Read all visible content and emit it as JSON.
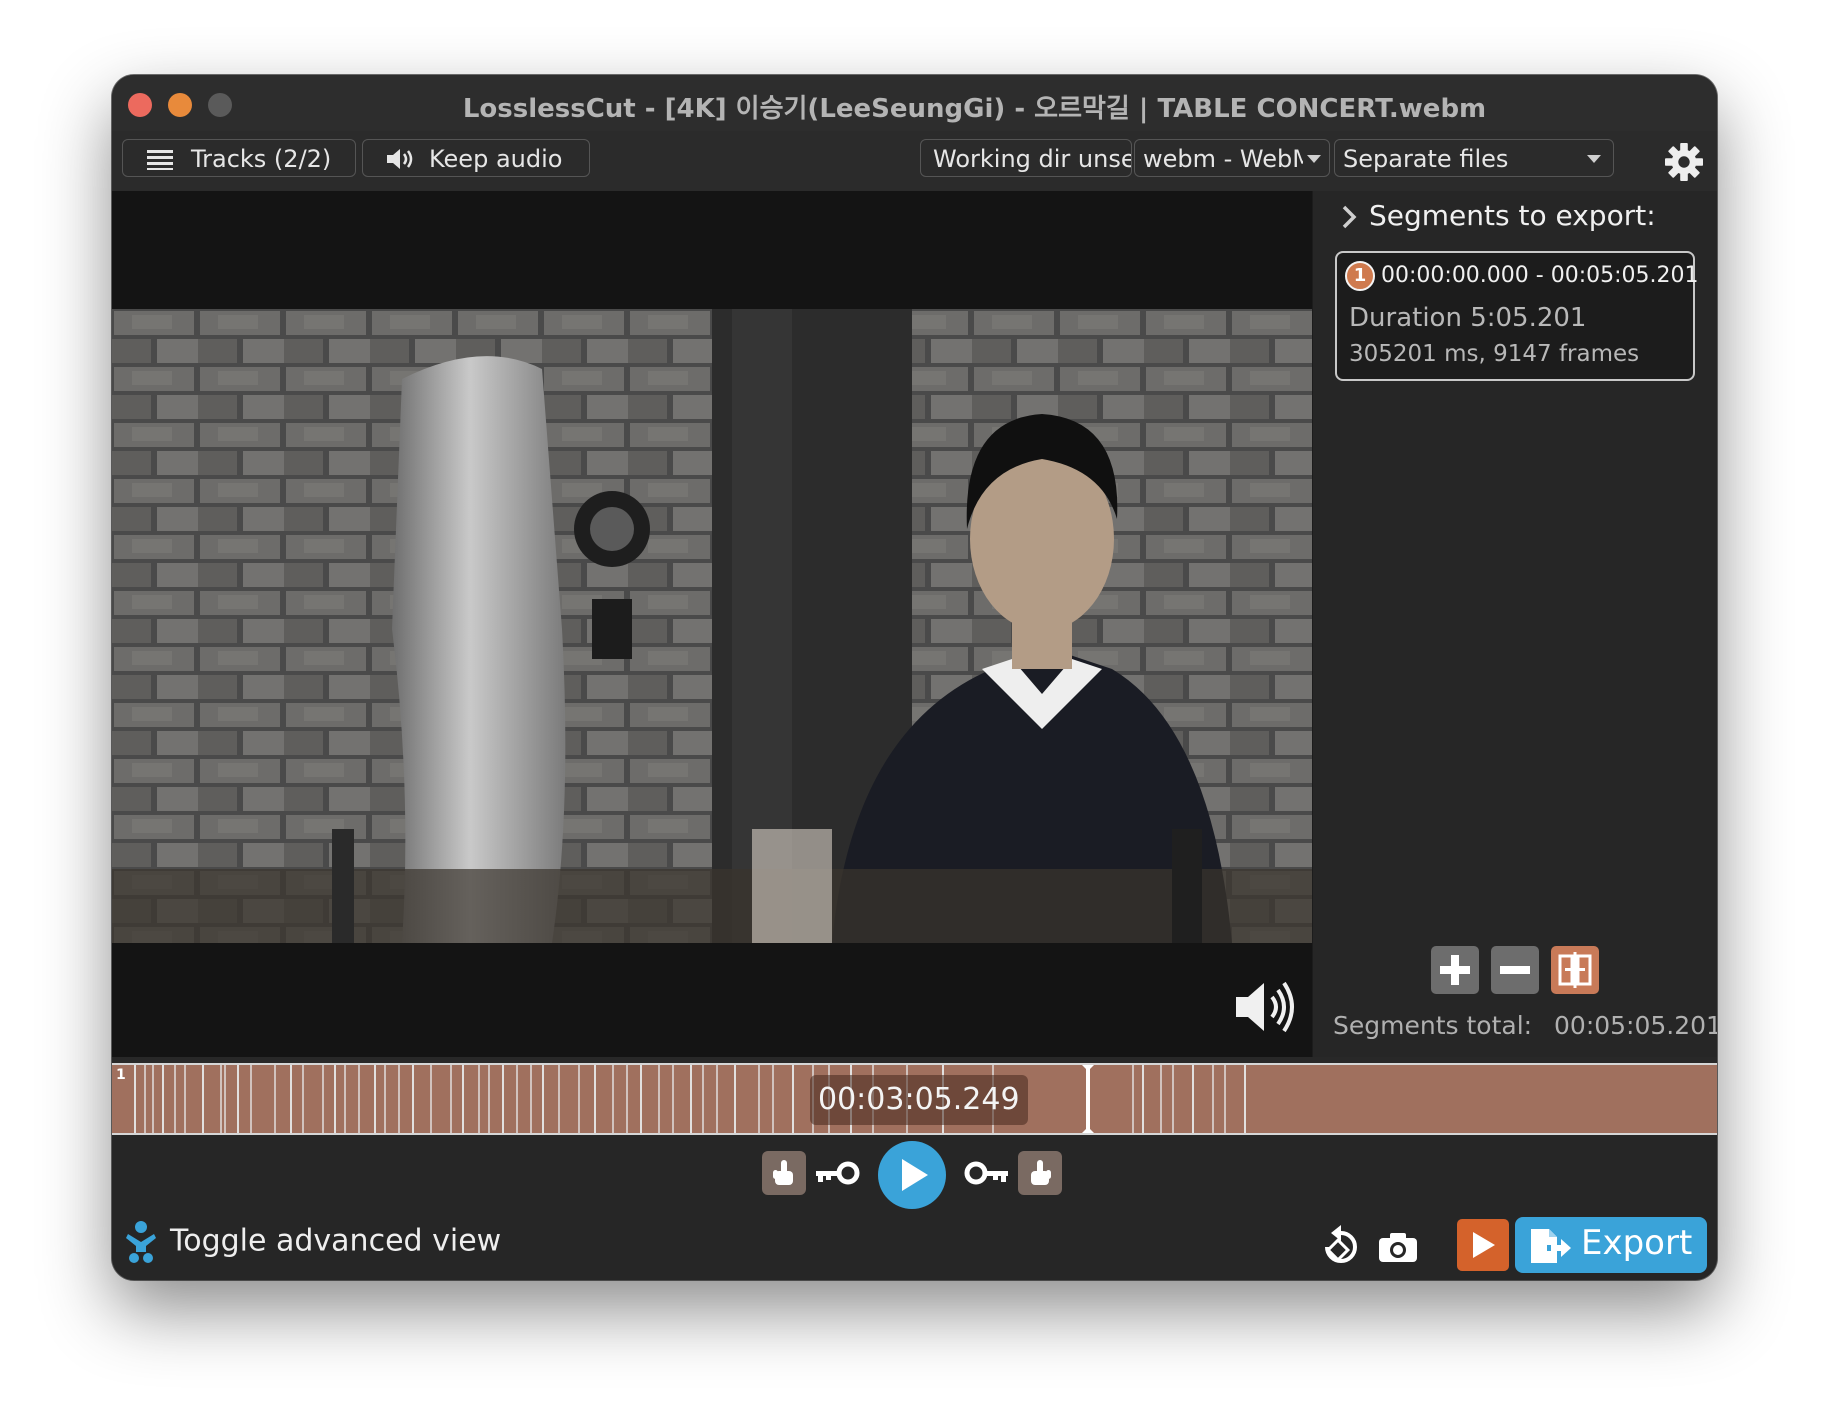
{
  "window": {
    "title": "LosslessCut - [4K] 이승기(LeeSeungGi) - 오르막길 | TABLE CONCERT.webm"
  },
  "toolbar": {
    "tracks_label": "Tracks (2/2)",
    "audio_label": "Keep audio",
    "working_dir_label": "Working dir unset",
    "format_label": "webm - WebM",
    "output_mode_label": "Separate files"
  },
  "segments": {
    "header": "Segments to export:",
    "items": [
      {
        "number": "1",
        "range": "00:00:00.000 - 00:05:05.201",
        "duration": "Duration 5:05.201",
        "detail": "305201 ms, 9147 frames"
      }
    ],
    "total_label": "Segments total:",
    "total_value": "00:05:05.201"
  },
  "timeline": {
    "segment_label": "1",
    "current_time": "00:03:05.249",
    "position": 0.607,
    "color": "#a0705e"
  },
  "controls": {
    "advanced_view_label": "Toggle advanced view",
    "export_label": "Export"
  },
  "colors": {
    "accent": "#3aa3d9",
    "segment": "#cf7a4e",
    "capture": "#d4622b"
  },
  "icons": {
    "tracks": "list-icon",
    "audio": "speaker-icon",
    "settings": "gear-icon",
    "volume": "volume-icon",
    "add": "plus-icon",
    "remove": "minus-icon",
    "split": "split-segment-icon",
    "set_start": "hand-point-left-icon",
    "jump_start": "key-left-icon",
    "play": "play-icon",
    "jump_end": "key-right-icon",
    "set_end": "hand-point-right-icon",
    "advanced": "baby-icon",
    "rotate": "rotate-icon",
    "capture": "camera-icon",
    "export": "export-file-icon"
  }
}
